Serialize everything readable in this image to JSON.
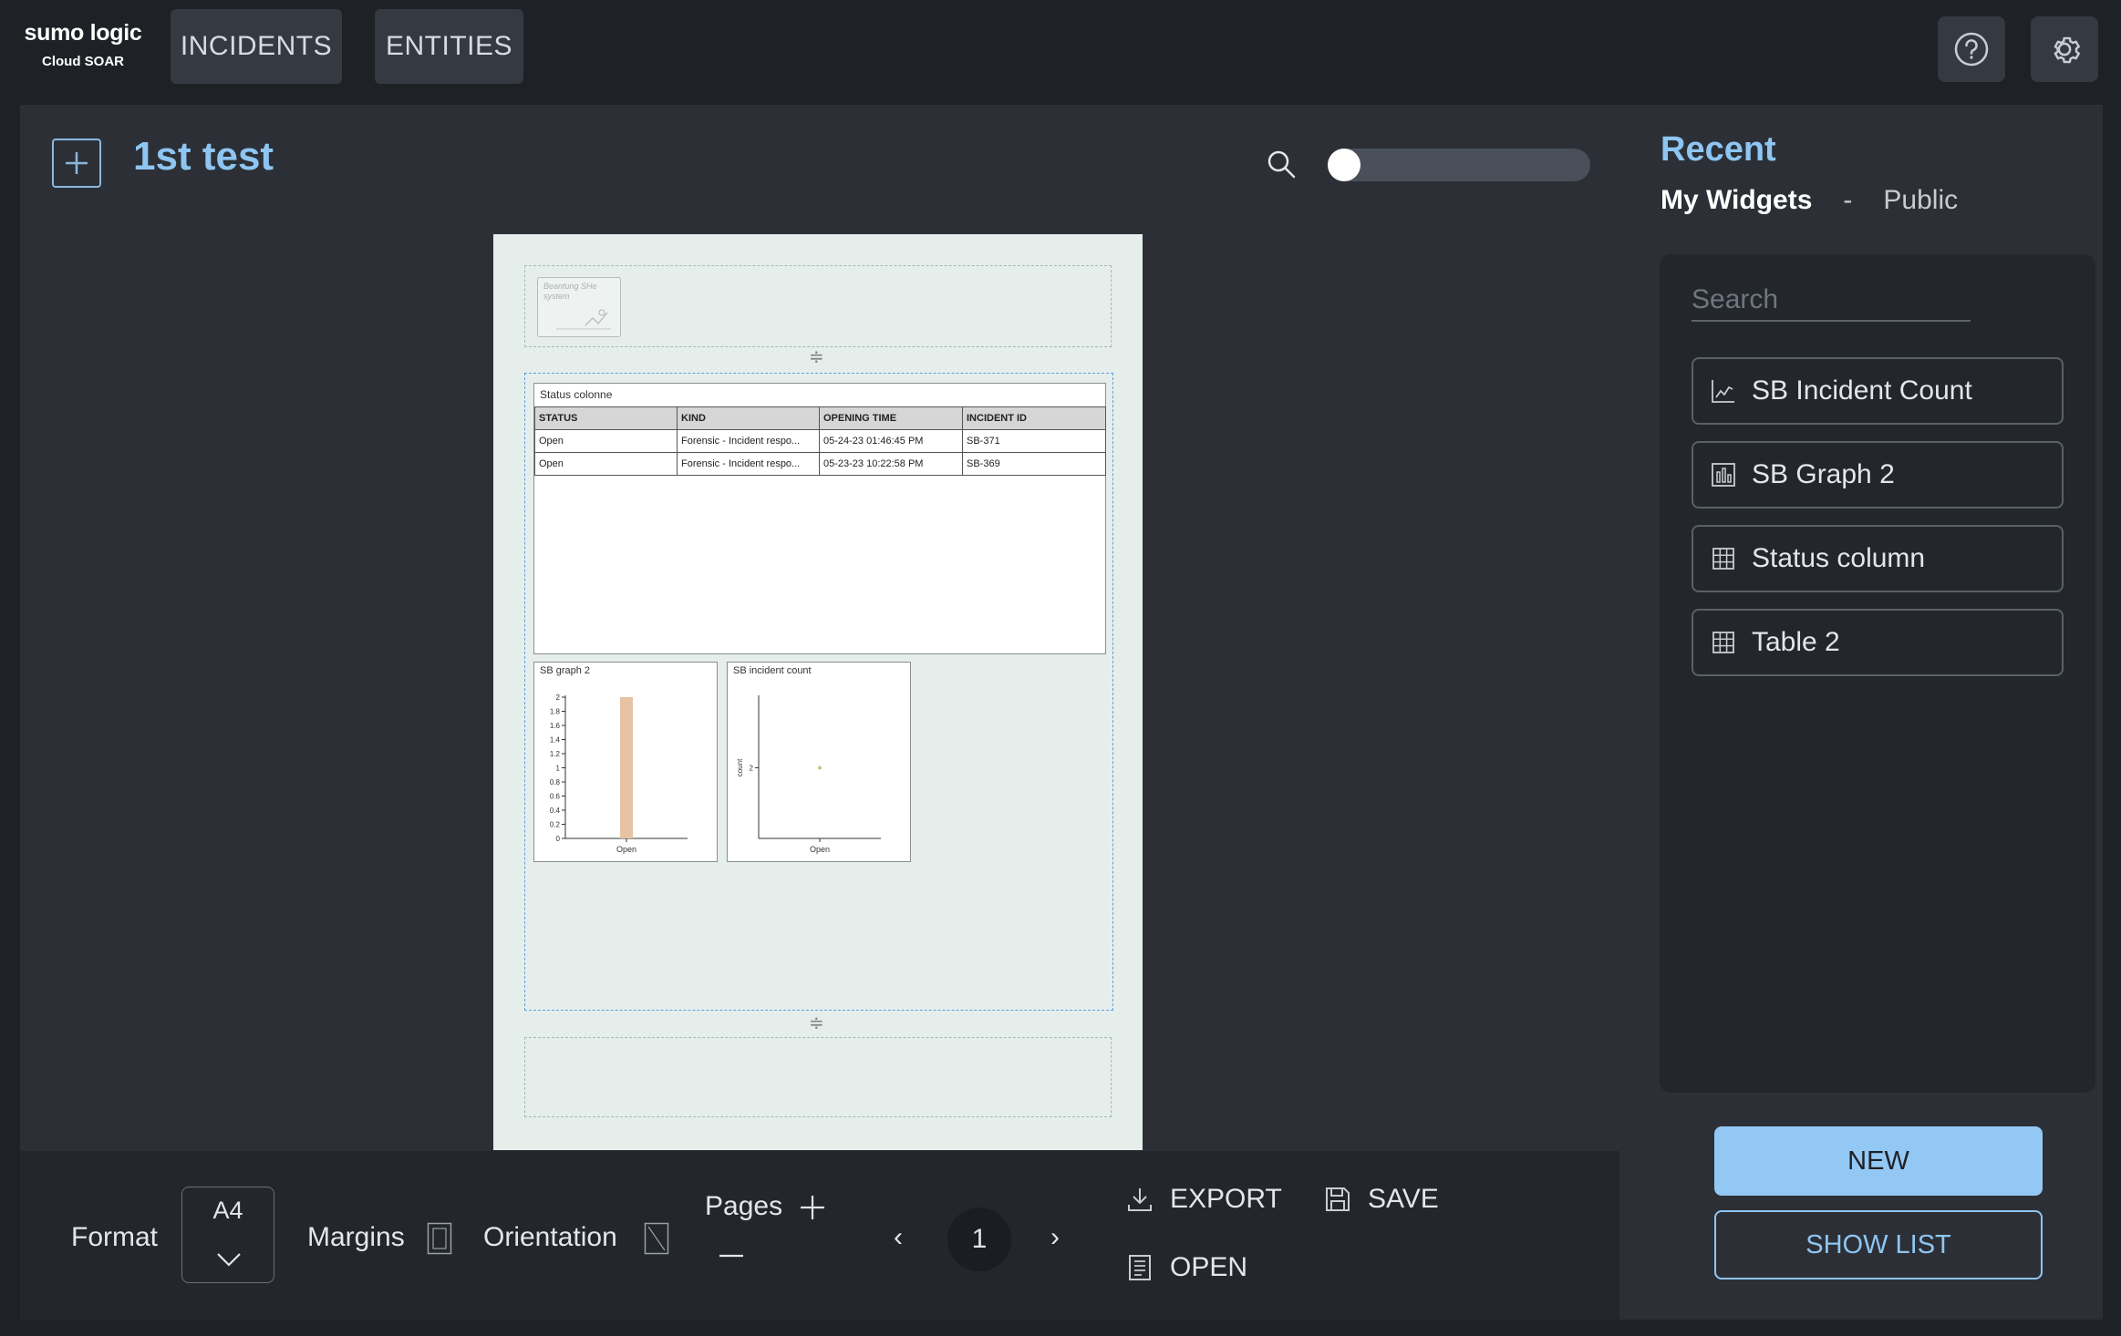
{
  "brand": {
    "name": "sumo logic",
    "product": "Cloud SOAR"
  },
  "nav": {
    "incidents": "INCIDENTS",
    "entities": "ENTITIES"
  },
  "header": {
    "help_icon": "help-icon",
    "settings_icon": "gear-icon"
  },
  "editor": {
    "title": "1st test",
    "zoom_level": 0,
    "logo_text": "Beantung SHe system",
    "table_widget": {
      "title": "Status colonne",
      "columns": [
        "STATUS",
        "KIND",
        "OPENING TIME",
        "INCIDENT ID"
      ],
      "rows": [
        [
          "Open",
          "Forensic - Incident respo...",
          "05-24-23 01:46:45 PM",
          "SB-371"
        ],
        [
          "Open",
          "Forensic - Incident respo...",
          "05-23-23 10:22:58 PM",
          "SB-369"
        ]
      ]
    }
  },
  "chart_data": [
    {
      "type": "bar",
      "title": "SB graph 2",
      "categories": [
        "Open"
      ],
      "values": [
        2
      ],
      "ylim": [
        0,
        2
      ],
      "yticks": [
        "0",
        "0.2",
        "0.4",
        "0.6",
        "0.8",
        "1",
        "1.2",
        "1.4",
        "1.6",
        "1.8",
        "2"
      ],
      "color": "#e6c3a3"
    },
    {
      "type": "scatter",
      "title": "SB incident count",
      "ylabel": "count",
      "categories": [
        "Open"
      ],
      "values": [
        2
      ],
      "yticks": [
        "2"
      ],
      "color": "#c9c48a"
    }
  ],
  "toolbar": {
    "format_label": "Format",
    "format_value": "A4",
    "margins_label": "Margins",
    "orientation_label": "Orientation",
    "pages_label": "Pages",
    "page_number": "1",
    "export_label": "EXPORT",
    "save_label": "SAVE",
    "open_label": "OPEN"
  },
  "sidebar": {
    "title": "Recent",
    "tab_active": "My Widgets",
    "tab_separator": "-",
    "tab_other": "Public",
    "search_placeholder": "Search",
    "items": [
      {
        "label": "SB Incident Count",
        "icon": "line-chart-icon"
      },
      {
        "label": "SB Graph 2",
        "icon": "bar-chart-icon"
      },
      {
        "label": "Status column",
        "icon": "table-icon"
      },
      {
        "label": "Table 2",
        "icon": "table-icon"
      }
    ],
    "new_label": "NEW",
    "show_list_label": "SHOW LIST"
  },
  "colors": {
    "accent": "#8ec5f2",
    "background": "#1e2126",
    "panel": "#2c3036"
  }
}
